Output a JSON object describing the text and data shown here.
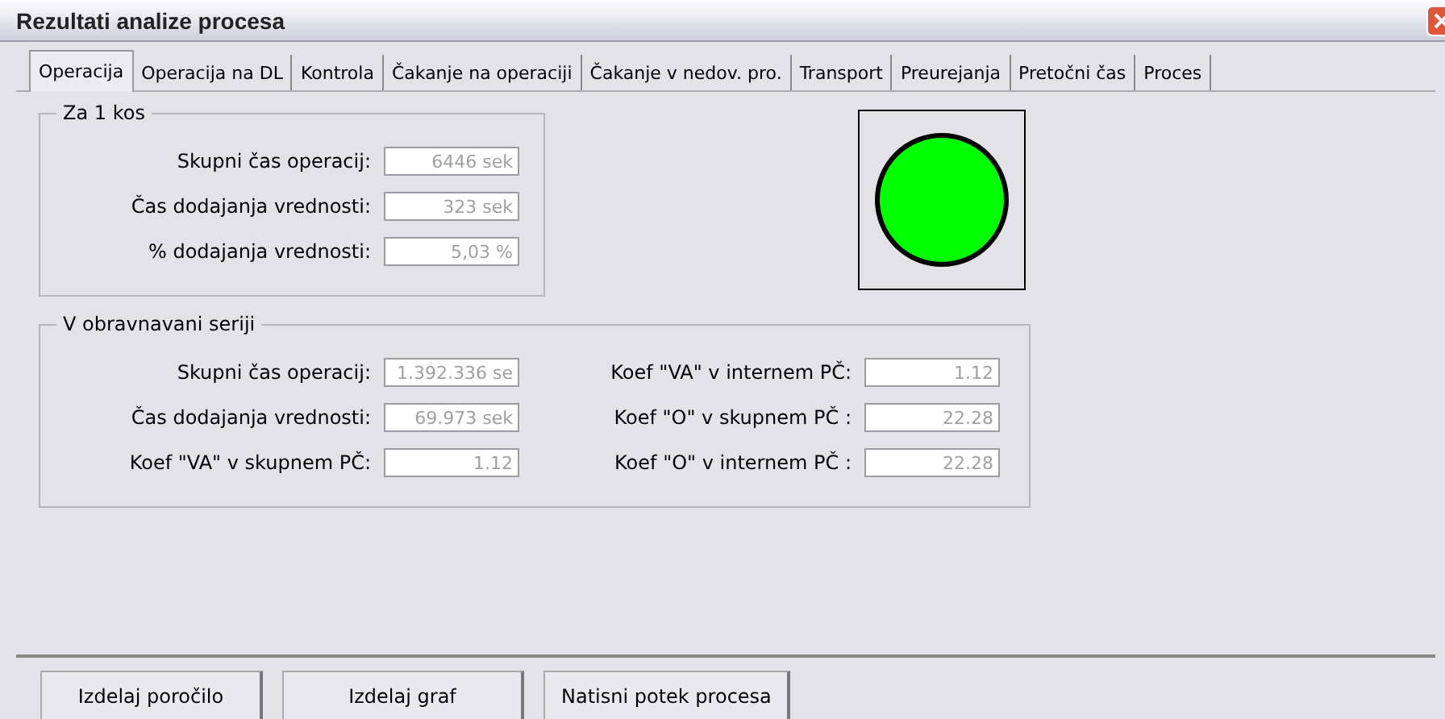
{
  "window": {
    "title": "Rezultati analize procesa"
  },
  "tabs": [
    {
      "label": "Operacija",
      "selected": true
    },
    {
      "label": "Operacija na DL",
      "selected": false
    },
    {
      "label": "Kontrola",
      "selected": false
    },
    {
      "label": "Čakanje na operaciji",
      "selected": false
    },
    {
      "label": "Čakanje v nedov. pro.",
      "selected": false
    },
    {
      "label": "Transport",
      "selected": false
    },
    {
      "label": "Preurejanja",
      "selected": false
    },
    {
      "label": "Pretočni čas",
      "selected": false
    },
    {
      "label": "Proces",
      "selected": false
    }
  ],
  "per_piece": {
    "title": "Za 1 kos",
    "fields": [
      {
        "label": "Skupni čas operacij:",
        "value": "6446 sek",
        "disabled": true
      },
      {
        "label": "Čas dodajanja vrednosti:",
        "value": "323 sek",
        "disabled": true
      },
      {
        "label": "% dodajanja vrednosti:",
        "value": "5,03 %",
        "disabled": true
      }
    ]
  },
  "indicator": {
    "color": "#00ff00"
  },
  "batch": {
    "title": "V obravnavani seriji",
    "left": [
      {
        "label": "Skupni čas operacij:",
        "value": "1.392.336 se",
        "disabled": true
      },
      {
        "label": "Čas dodajanja vrednosti:",
        "value": "69.973 sek",
        "disabled": true
      },
      {
        "label": "Koef \"VA\" v skupnem PČ:",
        "value": "1.12",
        "disabled": true
      }
    ],
    "right": [
      {
        "label": "Koef \"VA\" v internem PČ:",
        "value": "1.12",
        "disabled": true
      },
      {
        "label": "Koef \"O\" v skupnem PČ :",
        "value": "22.28",
        "disabled": true
      },
      {
        "label": "Koef \"O\" v internem PČ :",
        "value": "22.28",
        "disabled": true
      }
    ]
  },
  "buttons": [
    "Izdelaj poročilo",
    "Izdelaj graf",
    "Natisni potek procesa"
  ]
}
